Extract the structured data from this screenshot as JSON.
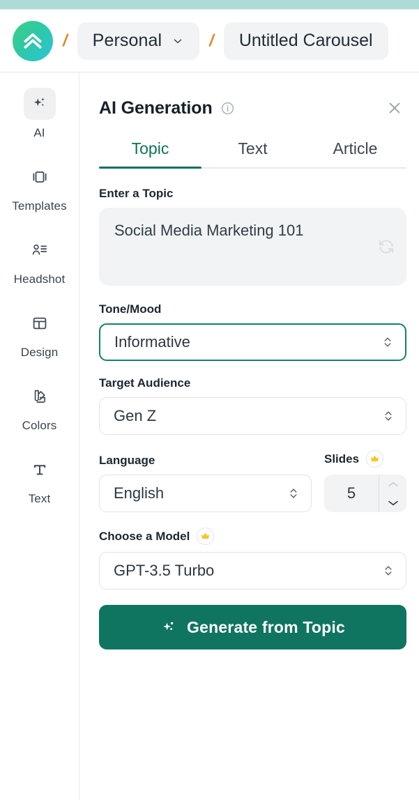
{
  "theme": {
    "accent": "#0f7560",
    "accent_dark": "#0d7259",
    "top_strip": "#addcd8",
    "chip_bg": "#f1f3f5",
    "crown": "#f7c62b",
    "logo_gradient_from": "#3ed17f",
    "logo_gradient_to": "#2bc5d6"
  },
  "header": {
    "logo_icon": "double-chevron-up-logo",
    "separator": "/",
    "workspace": {
      "label": "Personal",
      "caret_icon": "chevron-down-icon"
    },
    "document": {
      "label": "Untitled Carousel"
    }
  },
  "sidebar": {
    "items": [
      {
        "label": "AI",
        "icon": "sparkles-icon",
        "active": true
      },
      {
        "label": "Templates",
        "icon": "layout-panels-icon",
        "active": false
      },
      {
        "label": "Headshot",
        "icon": "user-list-icon",
        "active": false
      },
      {
        "label": "Design",
        "icon": "layout-dashboard-icon",
        "active": false
      },
      {
        "label": "Colors",
        "icon": "palette-icon",
        "active": false
      },
      {
        "label": "Text",
        "icon": "text-t-icon",
        "active": false
      }
    ]
  },
  "panel": {
    "title": "AI Generation",
    "info_icon": "info-circle-icon",
    "close_icon": "close-icon",
    "tabs": [
      {
        "label": "Topic",
        "active": true
      },
      {
        "label": "Text",
        "active": false
      },
      {
        "label": "Article",
        "active": false
      }
    ],
    "topic": {
      "label": "Enter a Topic",
      "value": "Social Media Marketing 101",
      "placeholder": "Enter a Topic",
      "refresh_icon": "refresh-icon"
    },
    "tone": {
      "label": "Tone/Mood",
      "value": "Informative",
      "focused": true,
      "arrows_icon": "chevron-up-down-icon"
    },
    "audience": {
      "label": "Target Audience",
      "value": "Gen Z",
      "focused": false,
      "arrows_icon": "chevron-up-down-icon"
    },
    "language": {
      "label": "Language",
      "value": "English",
      "arrows_icon": "chevron-up-down-icon"
    },
    "slides": {
      "label": "Slides",
      "value": "5",
      "premium_icon": "crown-icon",
      "increment_icon": "chevron-up-icon",
      "decrement_icon": "chevron-down-icon"
    },
    "model": {
      "label": "Choose a Model",
      "value": "GPT-3.5 Turbo",
      "premium_icon": "crown-icon",
      "arrows_icon": "chevron-up-down-icon"
    },
    "generate": {
      "label": "Generate from Topic",
      "icon": "sparkles-icon"
    }
  }
}
